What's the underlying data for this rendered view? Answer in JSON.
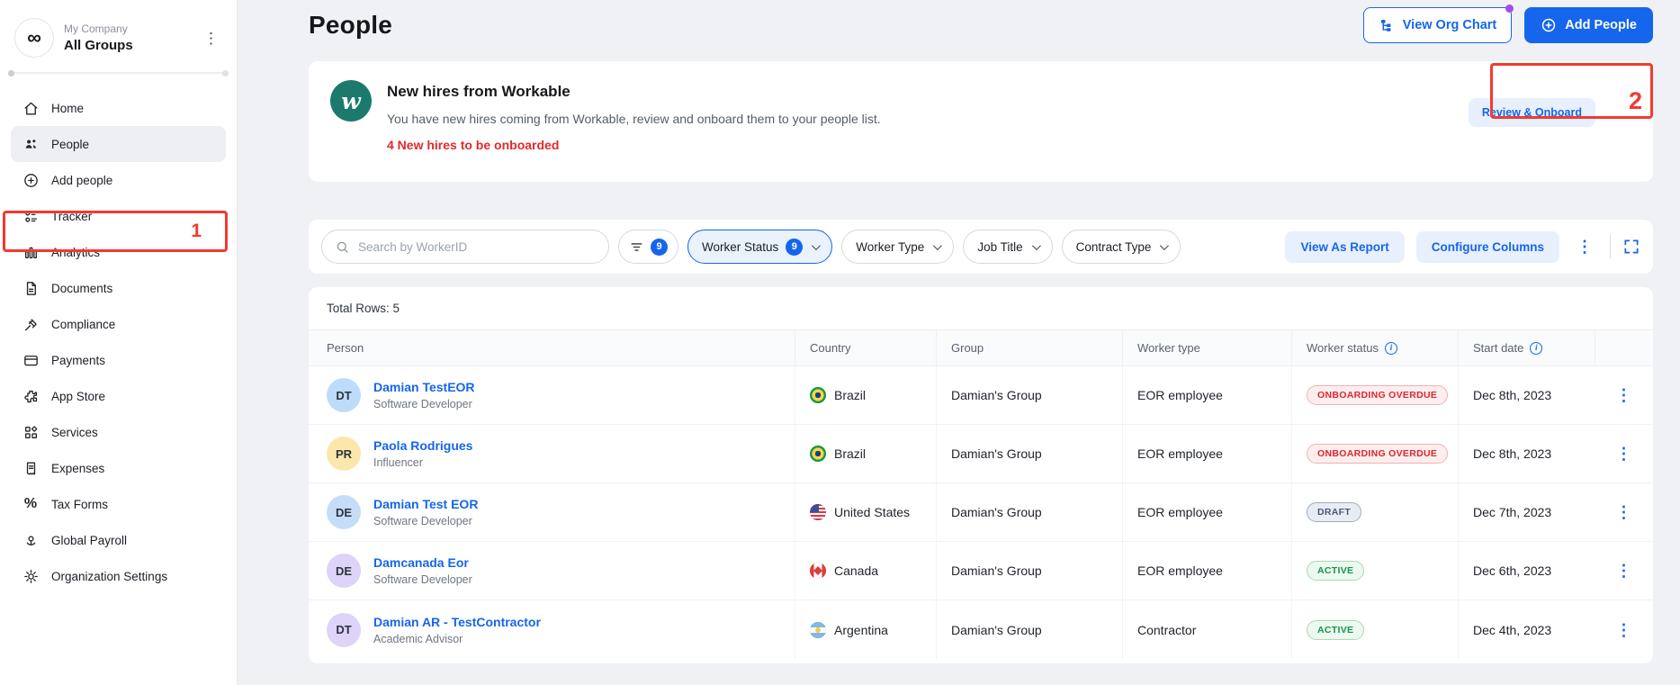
{
  "annotations": {
    "one": "1",
    "two": "2",
    "color": "#f23a2f"
  },
  "sidebar": {
    "company": {
      "name": "My Company",
      "group": "All Groups",
      "logo_glyph": "∞"
    },
    "items": [
      {
        "label": "Home",
        "icon": "home-icon",
        "active": false
      },
      {
        "label": "People",
        "icon": "people-icon",
        "active": true
      },
      {
        "label": "Add people",
        "icon": "add-circle-icon",
        "active": false
      },
      {
        "label": "Tracker",
        "icon": "tracker-icon",
        "active": false
      },
      {
        "label": "Analytics",
        "icon": "analytics-icon",
        "active": false
      },
      {
        "label": "Documents",
        "icon": "documents-icon",
        "active": false
      },
      {
        "label": "Compliance",
        "icon": "compliance-icon",
        "active": false
      },
      {
        "label": "Payments",
        "icon": "payments-icon",
        "active": false
      },
      {
        "label": "App Store",
        "icon": "app-store-icon",
        "active": false
      },
      {
        "label": "Services",
        "icon": "services-icon",
        "active": false
      },
      {
        "label": "Expenses",
        "icon": "expenses-icon",
        "active": false
      },
      {
        "label": "Tax Forms",
        "icon": "tax-forms-icon",
        "active": false
      },
      {
        "label": "Global Payroll",
        "icon": "global-payroll-icon",
        "active": false
      },
      {
        "label": "Organization Settings",
        "icon": "settings-gear-icon",
        "active": false
      }
    ]
  },
  "header": {
    "title": "People",
    "view_org_chart": "View Org Chart",
    "add_people": "Add People"
  },
  "banner": {
    "title": "New hires from Workable",
    "description": "You have new hires coming from Workable, review and onboard them to your people list.",
    "alert": "4 New hires to be onboarded",
    "action": "Review & Onboard",
    "logo_color": "#1b7a6b"
  },
  "filters": {
    "search_placeholder": "Search by WorkerID",
    "filter_count_badge": "9",
    "pills": [
      {
        "label": "Worker Status",
        "badge": "9",
        "selected": true
      },
      {
        "label": "Worker Type",
        "badge": null,
        "selected": false
      },
      {
        "label": "Job Title",
        "badge": null,
        "selected": false
      },
      {
        "label": "Contract Type",
        "badge": null,
        "selected": false
      }
    ],
    "view_as_report": "View As Report",
    "configure_columns": "Configure Columns"
  },
  "table": {
    "total_rows": "Total Rows: 5",
    "columns": [
      {
        "label": "Person",
        "info": false
      },
      {
        "label": "Country",
        "info": false
      },
      {
        "label": "Group",
        "info": false
      },
      {
        "label": "Worker type",
        "info": false
      },
      {
        "label": "Worker status",
        "info": true
      },
      {
        "label": "Start date",
        "info": true
      }
    ],
    "rows": [
      {
        "initials": "DT",
        "avatar_color": "#bcdcfa",
        "name": "Damian TestEOR",
        "job_title": "Software Developer",
        "country": "Brazil",
        "flag": "br",
        "group": "Damian's Group",
        "worker_type": "EOR employee",
        "status": "ONBOARDING OVERDUE",
        "status_type": "overdue",
        "start_date": "Dec 8th, 2023"
      },
      {
        "initials": "PR",
        "avatar_color": "#fbe7a9",
        "name": "Paola Rodrigues",
        "job_title": "Influencer",
        "country": "Brazil",
        "flag": "br",
        "group": "Damian's Group",
        "worker_type": "EOR employee",
        "status": "ONBOARDING OVERDUE",
        "status_type": "overdue",
        "start_date": "Dec 8th, 2023"
      },
      {
        "initials": "DE",
        "avatar_color": "#c6ddf8",
        "name": "Damian Test EOR",
        "job_title": "Software Developer",
        "country": "United States",
        "flag": "us",
        "group": "Damian's Group",
        "worker_type": "EOR employee",
        "status": "DRAFT",
        "status_type": "draft",
        "start_date": "Dec 7th, 2023"
      },
      {
        "initials": "DE",
        "avatar_color": "#ded3f8",
        "name": "Damcanada Eor",
        "job_title": "Software Developer",
        "country": "Canada",
        "flag": "ca",
        "group": "Damian's Group",
        "worker_type": "EOR employee",
        "status": "ACTIVE",
        "status_type": "active",
        "start_date": "Dec 6th, 2023"
      },
      {
        "initials": "DT",
        "avatar_color": "#ded3f8",
        "name": "Damian AR - TestContractor",
        "job_title": "Academic Advisor",
        "country": "Argentina",
        "flag": "ar",
        "group": "Damian's Group",
        "worker_type": "Contractor",
        "status": "ACTIVE",
        "status_type": "active",
        "start_date": "Dec 4th, 2023"
      }
    ]
  },
  "colors": {
    "accent_blue": "#1566ec",
    "soft_blue_bg": "#e8f0fd",
    "annotation_red": "#f23a2f",
    "alert_red": "#e02b2b",
    "status_overdue": "#e0252e",
    "status_draft": "#49597a",
    "status_active": "#12974c",
    "notification_purple": "#a34af0"
  }
}
